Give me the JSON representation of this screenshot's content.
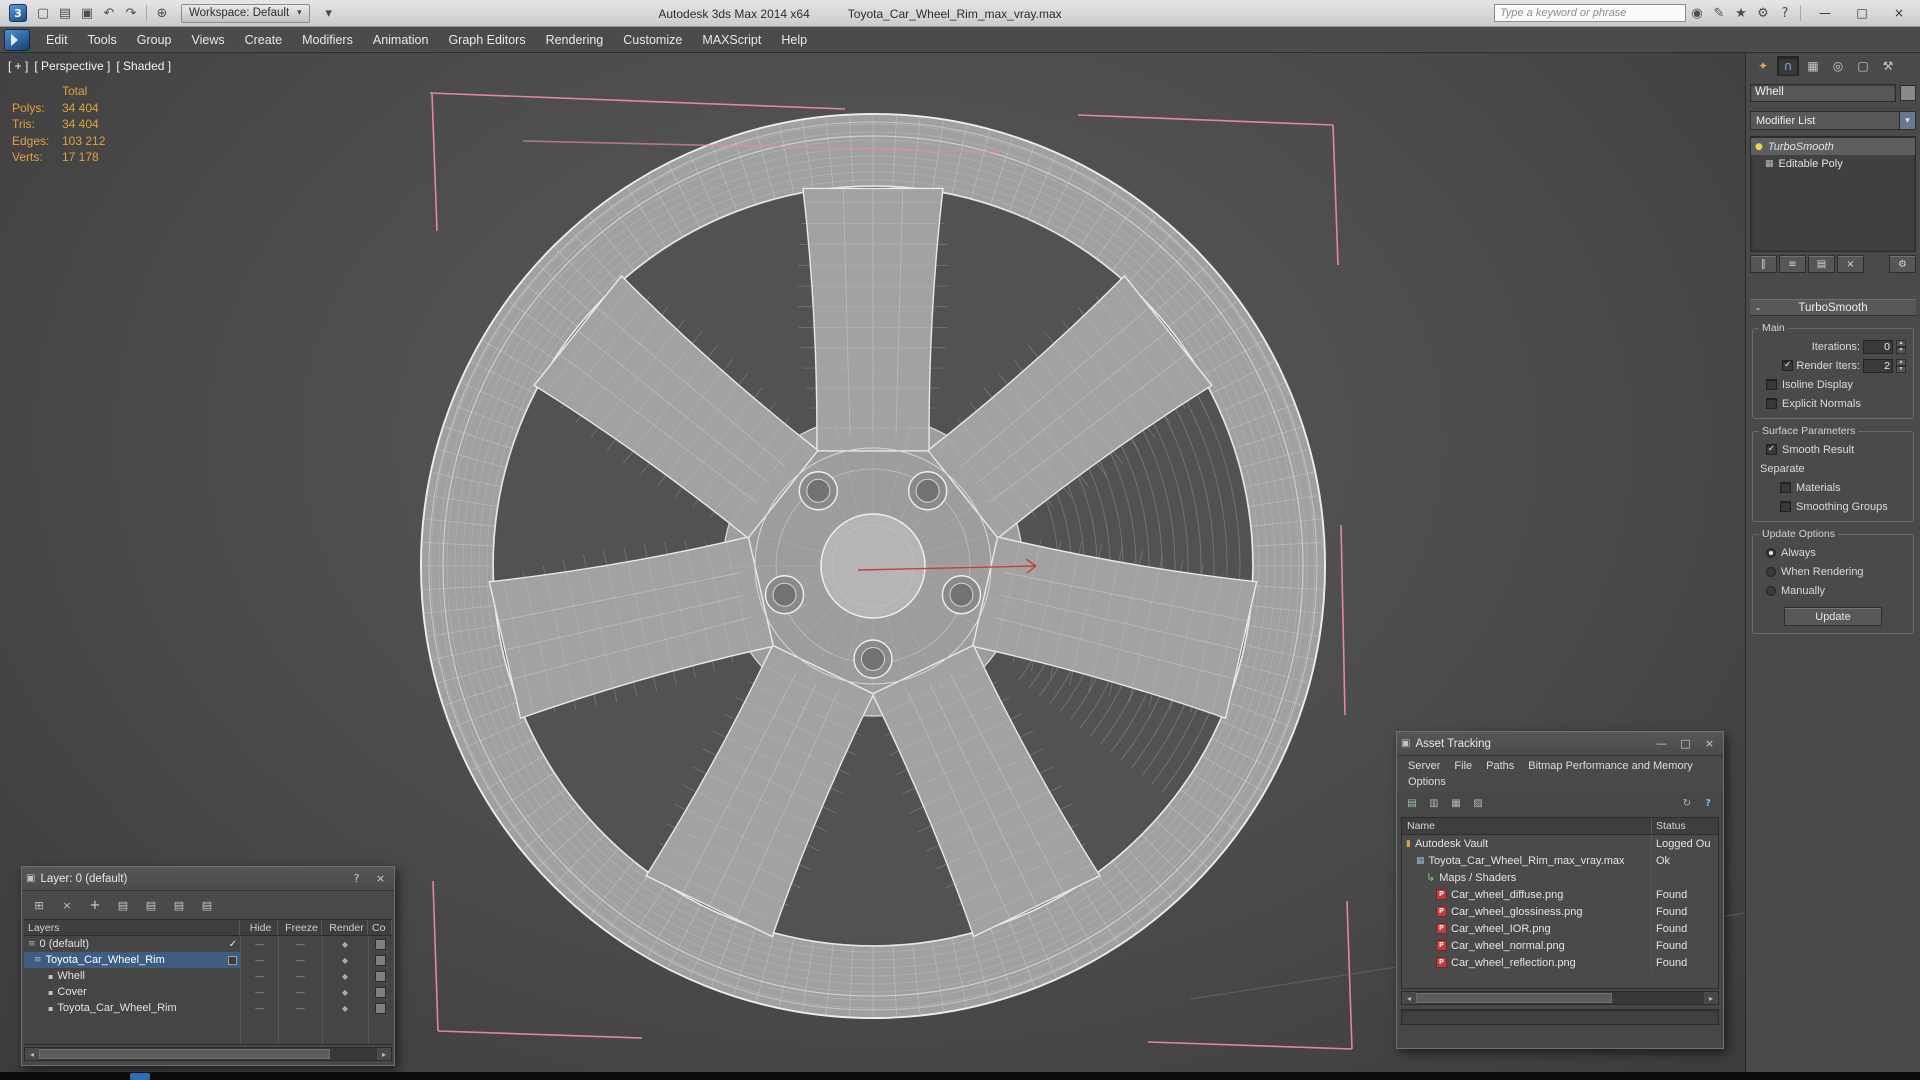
{
  "titlebar": {
    "app_title": "Autodesk 3ds Max 2014 x64",
    "doc_title": "Toyota_Car_Wheel_Rim_max_vray.max",
    "workspace": "Workspace: Default",
    "search_placeholder": "Type a keyword or phrase"
  },
  "menu": {
    "items": [
      "Edit",
      "Tools",
      "Group",
      "Views",
      "Create",
      "Modifiers",
      "Animation",
      "Graph Editors",
      "Rendering",
      "Customize",
      "MAXScript",
      "Help"
    ]
  },
  "viewport": {
    "labels": [
      "[ + ]",
      "[ Perspective ]",
      "[ Shaded ]"
    ],
    "stats": {
      "header": "Total",
      "rows": [
        {
          "label": "Polys:",
          "value": "34 404"
        },
        {
          "label": "Tris:",
          "value": "34 404"
        },
        {
          "label": "Edges:",
          "value": "103 212"
        },
        {
          "label": "Verts:",
          "value": "17 178"
        }
      ]
    }
  },
  "command_panel": {
    "object_name": "Whell",
    "modifier_list": "Modifier List",
    "stack": {
      "modifier": "TurboSmooth",
      "base": "Editable Poly"
    },
    "rollout": "TurboSmooth",
    "main": {
      "title": "Main",
      "iterations_label": "Iterations:",
      "iterations_value": "0",
      "render_iters_label": "Render Iters:",
      "render_iters_value": "2",
      "isoline": "Isoline Display",
      "explicit_normals": "Explicit Normals"
    },
    "surface": {
      "title": "Surface Parameters",
      "smooth_result": "Smooth Result",
      "separate": "Separate",
      "materials": "Materials",
      "smoothing_groups": "Smoothing Groups"
    },
    "update": {
      "title": "Update Options",
      "always": "Always",
      "when_rendering": "When Rendering",
      "manually": "Manually",
      "button": "Update"
    }
  },
  "layer_dialog": {
    "title": "Layer: 0 (default)",
    "columns": [
      "Layers",
      "Hide",
      "Freeze",
      "Render",
      "Co"
    ],
    "rows": [
      {
        "name": "0 (default)"
      },
      {
        "name": "Toyota_Car_Wheel_Rim"
      },
      {
        "name": "Whell"
      },
      {
        "name": "Cover"
      },
      {
        "name": "Toyota_Car_Wheel_Rim"
      }
    ]
  },
  "asset_tracking": {
    "title": "Asset Tracking",
    "menu": [
      "Server",
      "File",
      "Paths",
      "Bitmap Performance and Memory",
      "Options"
    ],
    "columns": [
      "Name",
      "Status"
    ],
    "rows": [
      {
        "name": "Autodesk Vault",
        "status": "Logged Ou"
      },
      {
        "name": "Toyota_Car_Wheel_Rim_max_vray.max",
        "status": "Ok"
      },
      {
        "name": "Maps / Shaders",
        "status": ""
      },
      {
        "name": "Car_wheel_diffuse.png",
        "status": "Found"
      },
      {
        "name": "Car_wheel_glossiness.png",
        "status": "Found"
      },
      {
        "name": "Car_wheel_IOR.png",
        "status": "Found"
      },
      {
        "name": "Car_wheel_normal.png",
        "status": "Found"
      },
      {
        "name": "Car_wheel_reflection.png",
        "status": "Found"
      }
    ]
  },
  "icons": {
    "app_logo": "3",
    "new": "▢",
    "open": "▤",
    "save": "▣",
    "undo": "↶",
    "redo": "↷",
    "fetch": "⊕",
    "caret": "▾",
    "binoculars": "◉",
    "pencil": "✎",
    "star": "★",
    "gear": "⚙",
    "help": "?",
    "minimize": "—",
    "maximize": "□",
    "close": "×",
    "tab_create": "✦",
    "tab_modify": "∩",
    "tab_hierarchy": "▦",
    "tab_motion": "◎",
    "tab_display": "▢",
    "tab_utilities": "⚒",
    "bulb": "●",
    "poly": "▦",
    "pin": "∥",
    "show_end": "≡",
    "make_unique": "▤",
    "remove": "×",
    "configure": "⚙",
    "spin_up": "▴",
    "spin_down": "▾",
    "check": "✓",
    "collapse": "-",
    "layer": "≡",
    "object": "▪",
    "dash": "-----",
    "render_cell": "◆",
    "dlg_icon": "▣",
    "lt_new": "⊞",
    "lt_del": "×",
    "lt_add": "+",
    "lt_list": "▤",
    "at_view1": "▤",
    "at_view2": "▥",
    "at_view3": "▦",
    "at_view4": "▨",
    "at_refresh": "↻",
    "maps_arrow": "↳",
    "vault": "▮",
    "maxfile": "▦",
    "png": "P",
    "arrow_left": "◂",
    "arrow_right": "▸"
  }
}
